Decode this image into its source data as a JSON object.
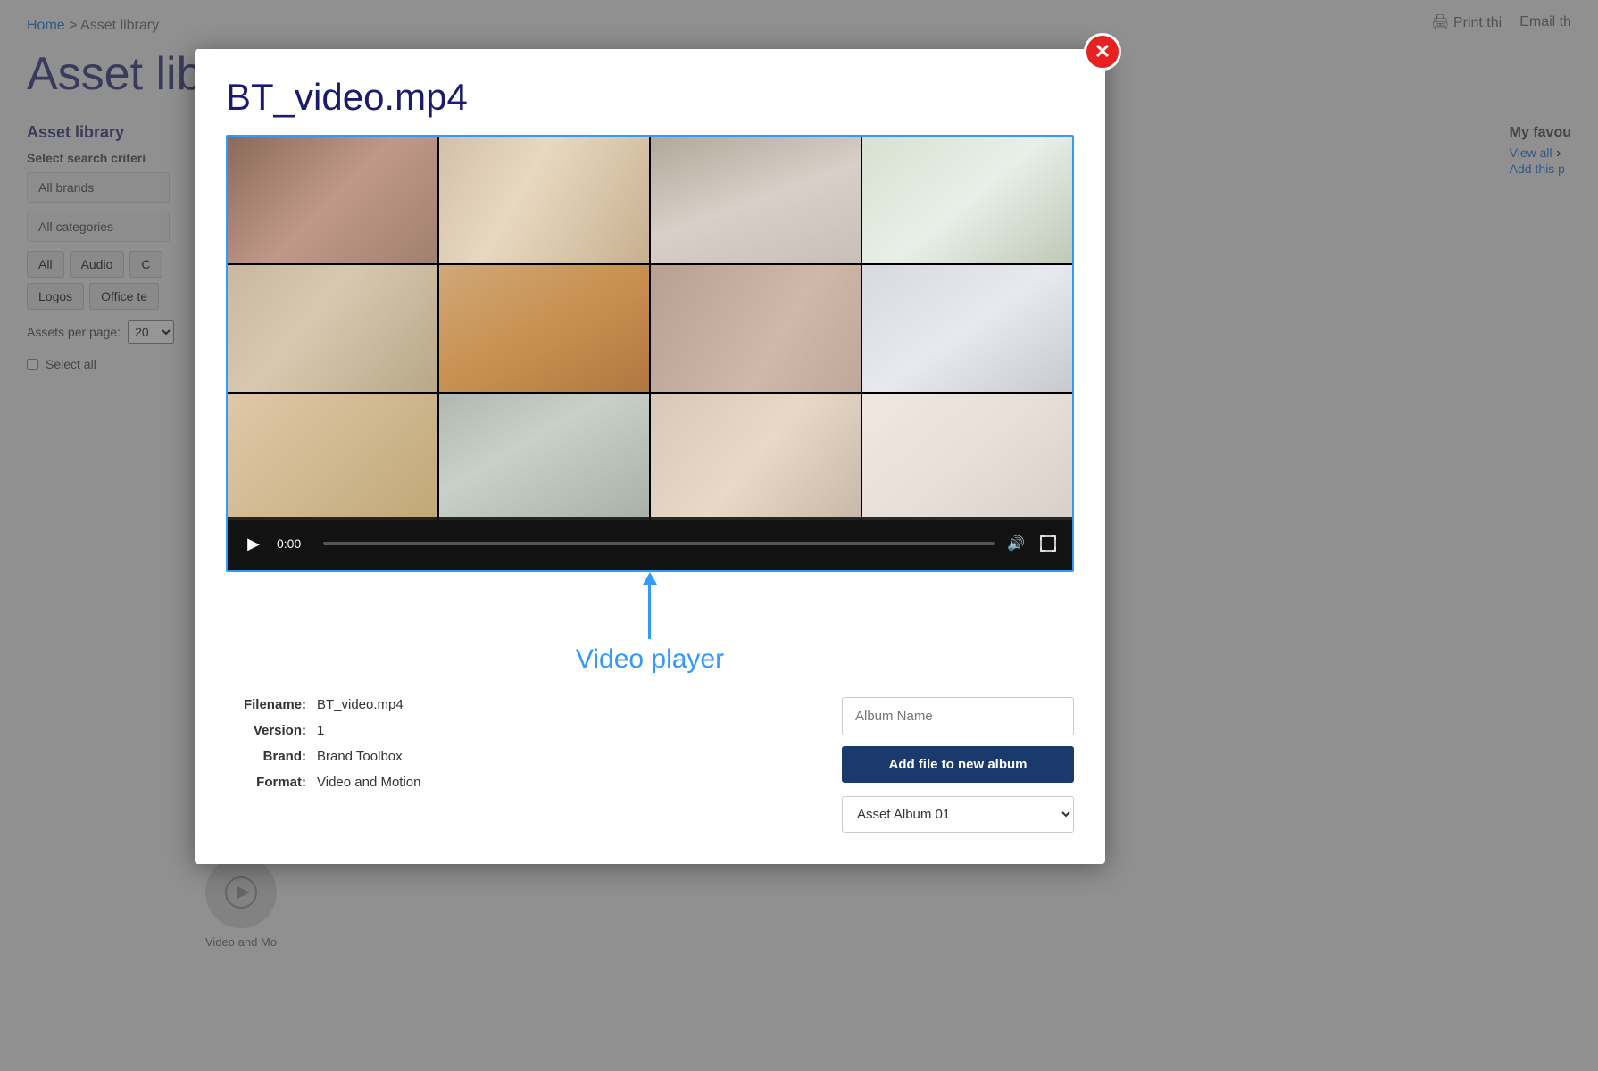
{
  "page": {
    "title": "Asset library",
    "breadcrumb_home": "Home",
    "breadcrumb_separator": ">",
    "breadcrumb_current": "Asset library"
  },
  "top_actions": {
    "print_label": "Print thi",
    "email_label": "Email th"
  },
  "sidebar": {
    "title": "Asset library",
    "search_criteria_label": "Select search criteri",
    "brand_filter": "All brands",
    "category_filter": "All categories",
    "type_buttons": [
      "All",
      "Audio",
      "C",
      "Logos",
      "Office te"
    ],
    "assets_per_page_label": "Assets per page:",
    "assets_per_page_value": "20",
    "select_all_label": "Select all"
  },
  "favourites": {
    "title": "My favou",
    "view_all_label": "View all",
    "add_page_label": "Add this p"
  },
  "modal": {
    "filename_display": "BT_video.mp4",
    "video_time": "0:00",
    "annotation_label": "Video player",
    "details": {
      "filename_label": "Filename:",
      "filename_value": "BT_video.mp4",
      "version_label": "Version:",
      "version_value": "1",
      "brand_label": "Brand:",
      "brand_value": "Brand Toolbox",
      "format_label": "Format:",
      "format_value": "Video and Motion"
    },
    "album": {
      "name_placeholder": "Album Name",
      "add_button_label": "Add file to new album",
      "select_label": "Asset Album 01"
    }
  },
  "thumbnail": {
    "label": "Video and Mo"
  },
  "icons": {
    "close": "✕",
    "play": "▶",
    "volume": "🔊",
    "fullscreen": "⛶",
    "printer": "🖨",
    "arrow_right": "›"
  }
}
